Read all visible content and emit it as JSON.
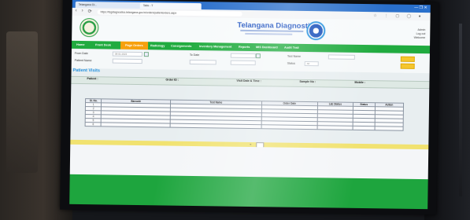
{
  "browser": {
    "tab1": "Telangana Di...",
    "tab2": "Tabs - T",
    "window_controls": "—  ❐  ✕",
    "nav_symbols": [
      "‹",
      "›",
      "⟳"
    ],
    "url": "https://tsgdiagnostics.telangana.gov.in/orders/patientorders.aspx",
    "ext_icons": "☆ ⋮ ▢ ◯ ●"
  },
  "header": {
    "brand": "Telangana Diagnostics",
    "user_lines": [
      "Admin",
      "Log out",
      "Welcome"
    ]
  },
  "nav": {
    "items": [
      "Home",
      "Front Desk",
      "Page Orders",
      "Radiology",
      "Consignments",
      "Inventory Management",
      "Reports",
      "MIS Dashboard",
      "Audit Trail"
    ],
    "active_index": 2
  },
  "filters": {
    "from_date_label": "From Date",
    "from_date_value": "08-01-2023",
    "to_date_label": "To Date",
    "to_date_value": "",
    "patient_name_label": "Patient Name",
    "patient_name_value": "",
    "test_name_label": "Test Name",
    "status_label": "Status",
    "status_value": "All"
  },
  "section": {
    "title": "Patient Visits"
  },
  "patient": {
    "name_label": "Patient :",
    "name_value": "",
    "order_label": "Order ID :",
    "order_value": "",
    "visit_label": "Visit Date & Time :",
    "visit_value": "",
    "sample_label": "Sample No :",
    "sample_value": "",
    "mobile_label": "Mobile :",
    "mobile_value": ""
  },
  "table": {
    "headers": [
      "Sl. No.",
      "Barcode",
      "Test Name",
      "Order Date",
      "Lab Status",
      "Status",
      "Action"
    ],
    "rows": [
      [
        "1",
        "",
        "",
        "",
        "",
        "",
        ""
      ],
      [
        "2",
        "",
        "",
        "",
        "",
        "",
        ""
      ],
      [
        "3",
        "",
        "",
        "",
        "",
        "",
        ""
      ],
      [
        "4",
        "",
        "",
        "",
        "",
        "",
        ""
      ],
      [
        "5",
        "",
        "",
        "",
        "",
        "",
        ""
      ],
      [
        "6",
        "",
        "",
        "",
        "",
        "",
        ""
      ]
    ]
  },
  "pager": {
    "prev": "«",
    "page": "1"
  }
}
